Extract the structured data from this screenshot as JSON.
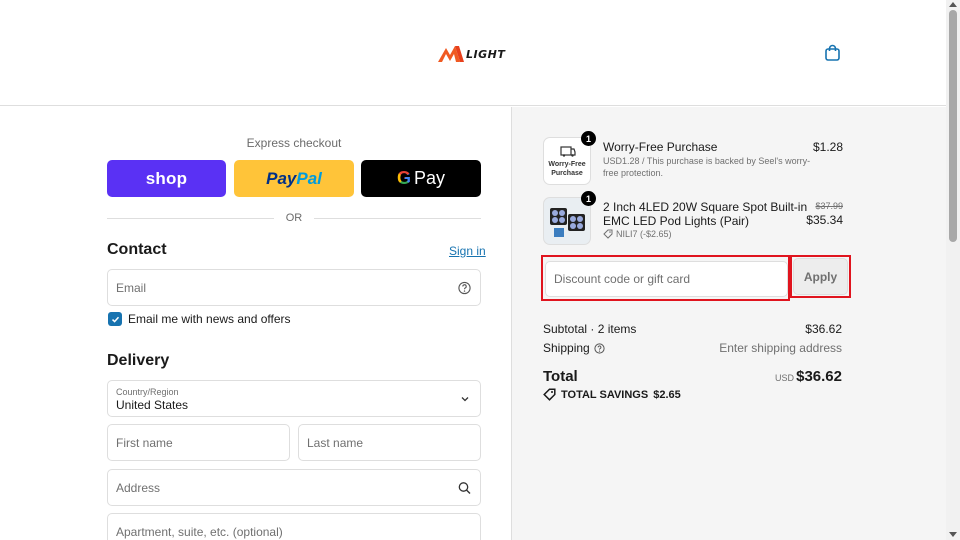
{
  "brand": {
    "logo_text": "LIGHT"
  },
  "express": {
    "title": "Express checkout",
    "shop_label": "shop",
    "paypal_part1": "Pay",
    "paypal_part2": "Pal",
    "gpay_g": "G",
    "gpay_label": "Pay",
    "or_label": "OR"
  },
  "contact": {
    "title": "Contact",
    "signin_label": "Sign in",
    "email_placeholder": "Email",
    "newsletter_label": "Email me with news and offers",
    "newsletter_checked": true
  },
  "delivery": {
    "title": "Delivery",
    "country_label": "Country/Region",
    "country_value": "United States",
    "first_name_placeholder": "First name",
    "last_name_placeholder": "Last name",
    "address_placeholder": "Address",
    "apartment_placeholder": "Apartment, suite, etc. (optional)"
  },
  "cart": {
    "items": [
      {
        "qty": "1",
        "thumb_line1": "Worry-Free",
        "thumb_line2": "Purchase",
        "name": "Worry-Free Purchase",
        "desc_line1": "USD1.28 / This purchase is backed by Seel's worry-",
        "desc_line2": "free protection.",
        "price": "$1.28"
      },
      {
        "qty": "1",
        "name_line1": "2 Inch 4LED 20W Square Spot Built-in",
        "name_line2": "EMC LED Pod Lights (Pair)",
        "discount_tag": "NILI7 (-$2.65)",
        "original_price": "$37.99",
        "price": "$35.34"
      }
    ],
    "discount_placeholder": "Discount code or gift card",
    "apply_label": "Apply",
    "subtotal_label": "Subtotal · 2 items",
    "subtotal_value": "$36.62",
    "shipping_label": "Shipping",
    "shipping_value": "Enter shipping address",
    "total_label": "Total",
    "total_currency": "USD",
    "total_value": "$36.62",
    "savings_label": "TOTAL SAVINGS",
    "savings_value": "$2.65"
  },
  "colors": {
    "accent": "#1773b0",
    "shop": "#5a31f4",
    "paypal": "#ffc439",
    "highlight": "#e0141e",
    "logo_orange": "#f05a22"
  }
}
